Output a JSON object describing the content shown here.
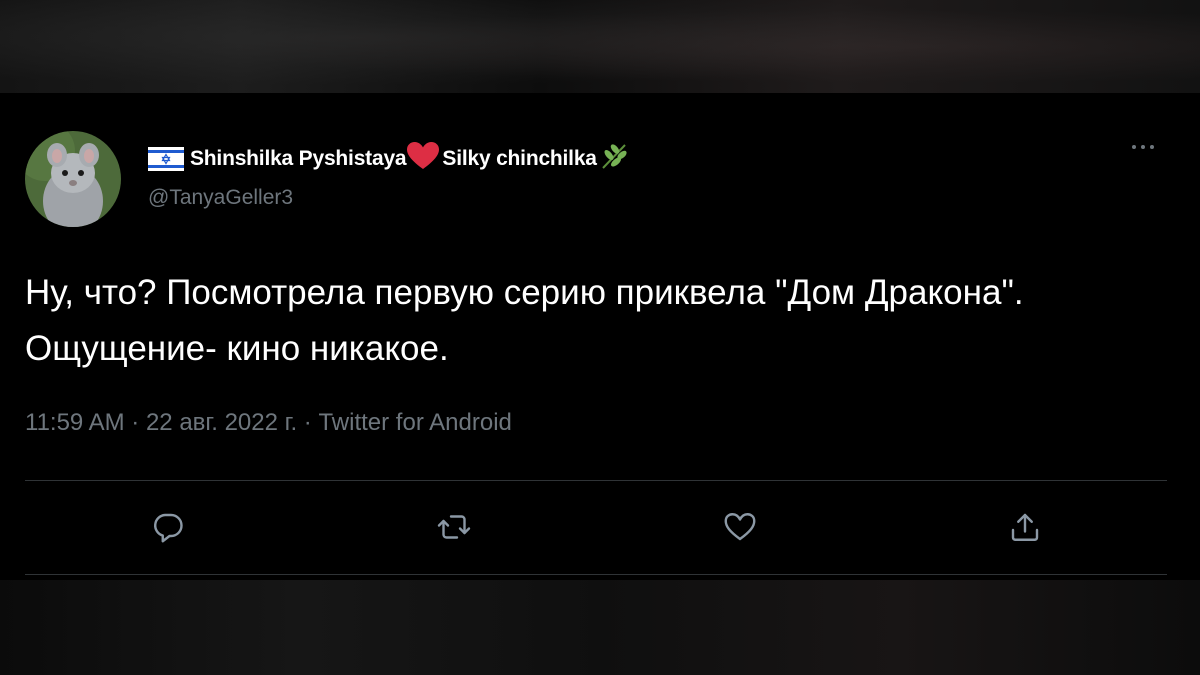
{
  "tweet": {
    "display_name": "Shinshilka Pyshistaya",
    "display_name_suffix": "Silky chinchilka",
    "handle": "@TanyaGeller3",
    "text": "Ну, что? Посмотрела первую серию приквела \"Дом Дракона\". Ощущение- кино никакое.",
    "time": "11:59 AM",
    "date": "22 авг. 2022 г.",
    "source": "Twitter for Android",
    "separator": " · "
  },
  "icons": {
    "flag": "israel-flag-icon",
    "heart": "red-heart-emoji-icon",
    "herb": "herb-emoji-icon",
    "more": "more-icon",
    "reply": "reply-icon",
    "retweet": "retweet-icon",
    "like": "like-icon",
    "share": "share-icon"
  },
  "colors": {
    "background": "#000000",
    "secondary_text": "#6e767d",
    "divider": "#2f3336",
    "heart": "#e0245e"
  }
}
